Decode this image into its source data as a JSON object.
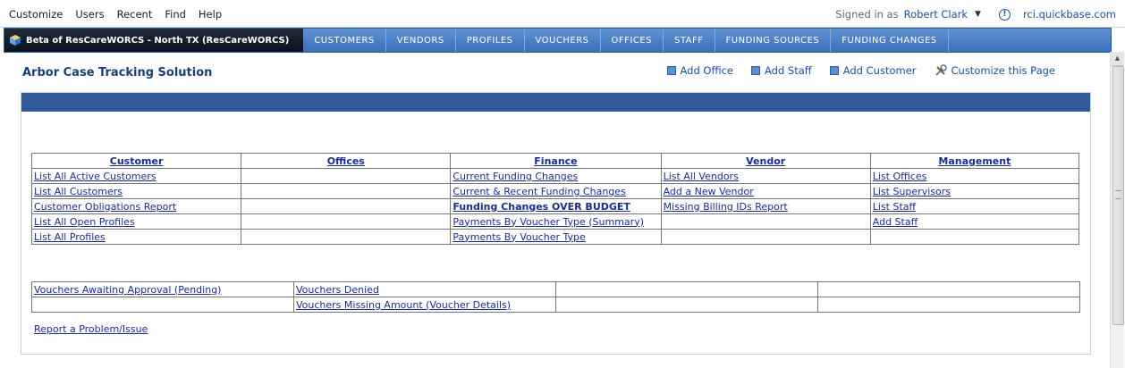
{
  "topmenu": {
    "items": [
      "Customize",
      "Users",
      "Recent",
      "Find",
      "Help"
    ]
  },
  "signin": {
    "label": "Signed in as",
    "user": "Robert Clark",
    "domain": "rci.quickbase.com"
  },
  "nav": {
    "app_name": "Beta of ResCareWORCS - North TX (ResCareWORCS)",
    "tabs": [
      "CUSTOMERS",
      "VENDORS",
      "PROFILES",
      "VOUCHERS",
      "OFFICES",
      "STAFF",
      "FUNDING SOURCES",
      "FUNDING CHANGES"
    ]
  },
  "page": {
    "title": "Arbor Case Tracking Solution"
  },
  "actions": {
    "add_office": "Add Office",
    "add_staff": "Add Staff",
    "add_customer": "Add Customer",
    "customize": "Customize this Page"
  },
  "grid": {
    "headers": [
      "Customer",
      "Offices",
      "Finance",
      "Vendor",
      "Management "
    ],
    "rows": [
      [
        "List All Active Customers",
        "",
        "Current Funding Changes",
        "List All Vendors ",
        "List Offices "
      ],
      [
        "List All Customers",
        "",
        "Current & Recent Funding Changes",
        "Add a New Vendor",
        "List Supervisors"
      ],
      [
        "Customer Obligations Report",
        "",
        "Funding Changes OVER BUDGET",
        "Missing Billing IDs Report",
        "List Staff"
      ],
      [
        "List All Open Profiles",
        "",
        "Payments By Voucher Type (Summary)",
        "",
        "Add Staff"
      ],
      [
        "List All Profiles",
        "",
        "Payments By Voucher Type",
        "",
        ""
      ]
    ]
  },
  "vouchers": {
    "rows": [
      [
        "Vouchers Awaiting Approval (Pending)",
        "Vouchers Denied",
        "",
        ""
      ],
      [
        "",
        "Vouchers Missing Amount (Voucher Details)",
        "",
        ""
      ]
    ]
  },
  "report_link": "Report a Problem/Issue",
  "colors": {
    "nav_blue": "#3b70b8",
    "panel_bar": "#2f5c98",
    "link": "#1a2c8e",
    "title": "#1b3f75"
  }
}
